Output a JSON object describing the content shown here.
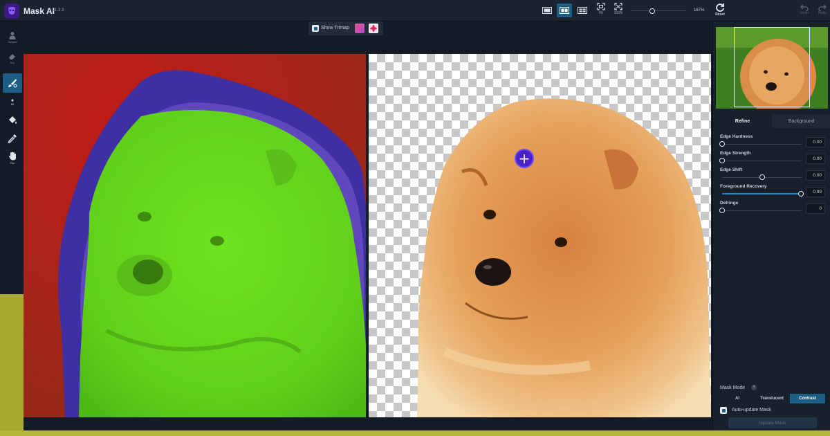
{
  "app": {
    "title": "Mask AI",
    "version": "v1.3.3"
  },
  "toolbar": {
    "view_buttons": [
      "single-view-icon",
      "split-view-icon",
      "side-by-side-view-icon"
    ],
    "active_view": 1,
    "fit_label": "Fit",
    "full_label": "100%",
    "zoom_value": "167%",
    "reset_label": "Reset",
    "undo_label": "Undo",
    "redo_label": "Redo"
  },
  "left_tools": [
    {
      "name": "subject",
      "label": "Subject",
      "icon": "person-icon"
    },
    {
      "name": "sky",
      "label": "Sky",
      "icon": "eraser-icon"
    },
    {
      "name": "brush",
      "label": "",
      "icon": "brush-icon",
      "active": true
    },
    {
      "name": "size",
      "label": "60",
      "icon": "dot-icon"
    },
    {
      "name": "fill",
      "label": "",
      "icon": "bucket-icon"
    },
    {
      "name": "eyedropper",
      "label": "",
      "icon": "eyedropper-icon"
    },
    {
      "name": "pan",
      "label": "Pan",
      "icon": "hand-icon"
    }
  ],
  "trimap": {
    "label": "Show Trimap",
    "checked": true
  },
  "right_panel": {
    "tabs": {
      "refine": "Refine",
      "background": "Background"
    },
    "sliders": [
      {
        "label": "Edge Hardness",
        "value": "0.00",
        "level": 0.0
      },
      {
        "label": "Edge Strength",
        "value": "0.00",
        "level": 0.0
      },
      {
        "label": "Edge Shift",
        "value": "0.00",
        "level": 0.5
      },
      {
        "label": "Foreground Recovery",
        "value": "0.99",
        "level": 0.99
      },
      {
        "label": "Defringe",
        "value": "0",
        "level": 0.0
      }
    ],
    "mask_mode": {
      "title": "Mask Mode",
      "help": "?",
      "options": [
        "AI",
        "Translucent",
        "Contrast"
      ],
      "selected": "Contrast"
    },
    "auto_update": {
      "label": "Auto-update Mask",
      "checked": true
    },
    "update_button": "Update Mask"
  },
  "colors": {
    "accent": "#1d5e86",
    "trimap_foreground": "#6edc1e",
    "trimap_edge": "#4b3ab4",
    "trimap_background": "#b01818",
    "cursor": "#4a22c8"
  }
}
